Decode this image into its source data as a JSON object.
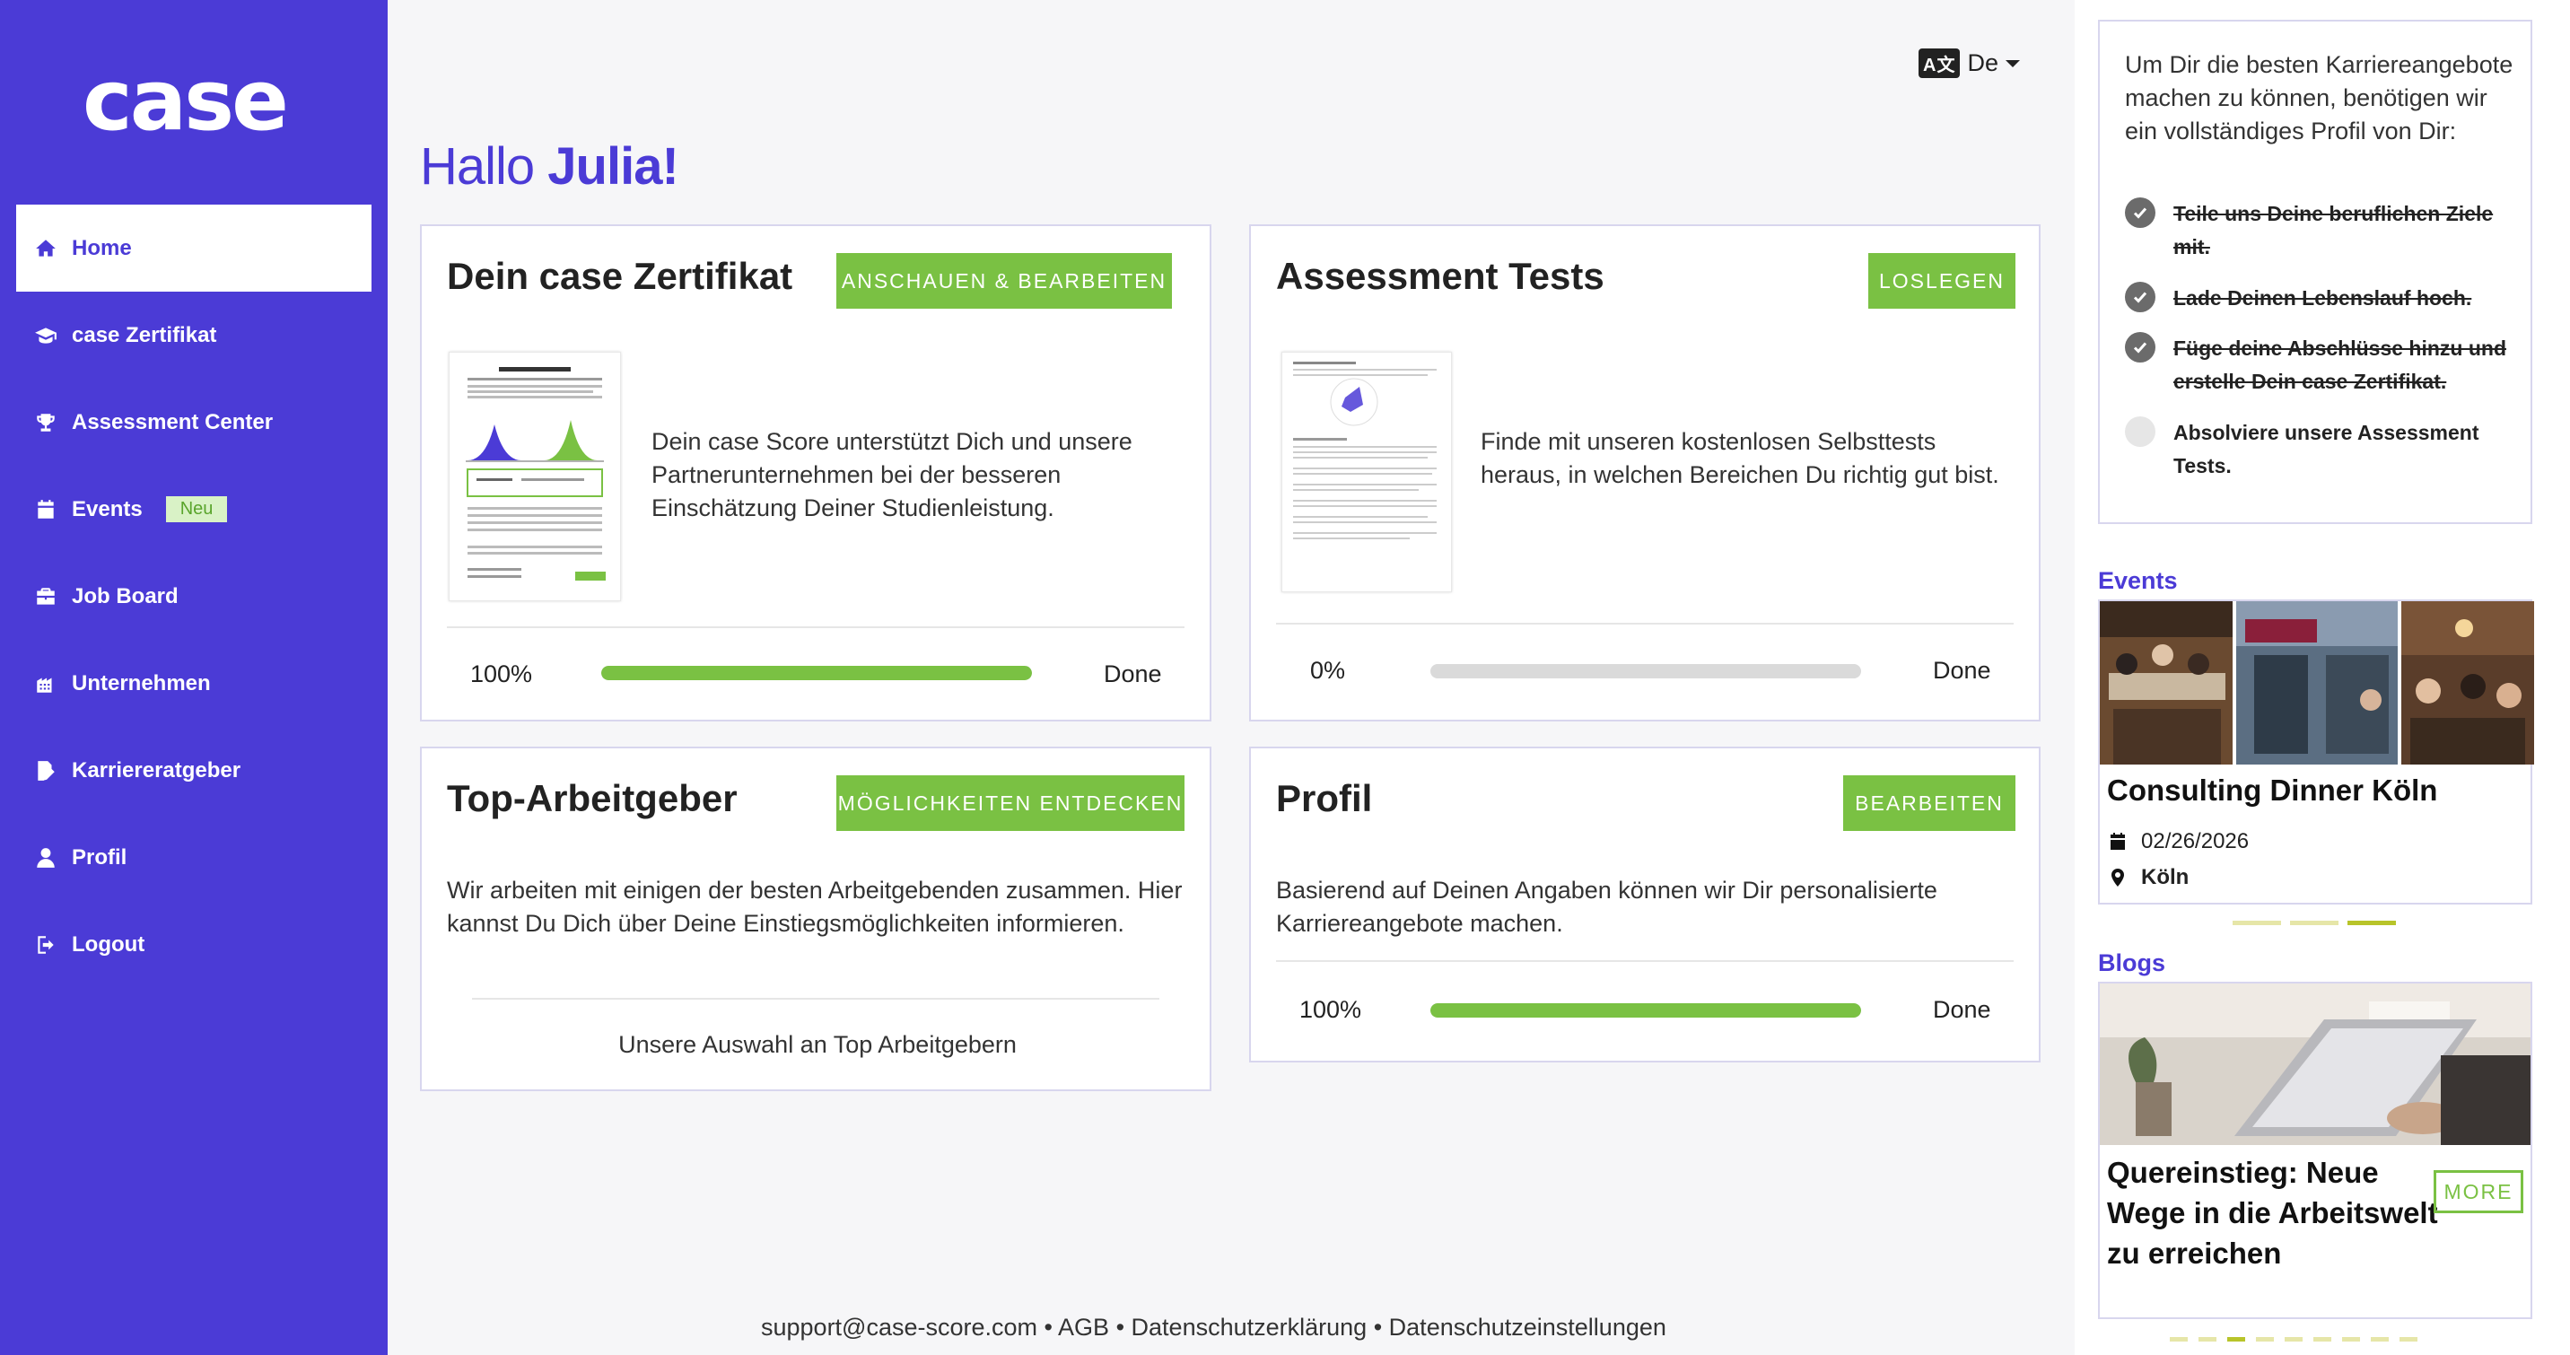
{
  "brand": {
    "logo_text": "case",
    "accent": "#4b3bd6",
    "green": "#7ac143"
  },
  "sidebar": {
    "items": [
      {
        "label": "Home",
        "icon": "home-icon",
        "active": true
      },
      {
        "label": "case Zertifikat",
        "icon": "graduation-cap-icon"
      },
      {
        "label": "Assessment Center",
        "icon": "trophy-icon"
      },
      {
        "label": "Events",
        "icon": "calendar-icon",
        "badge": "Neu"
      },
      {
        "label": "Job Board",
        "icon": "briefcase-icon"
      },
      {
        "label": "Unternehmen",
        "icon": "building-icon"
      },
      {
        "label": "Karriereratgeber",
        "icon": "edit-file-icon"
      },
      {
        "label": "Profil",
        "icon": "user-icon"
      },
      {
        "label": "Logout",
        "icon": "logout-icon"
      }
    ]
  },
  "header": {
    "language": "De",
    "language_icon": "translate-icon"
  },
  "greeting": {
    "prefix": "Hallo",
    "name": "Julia!"
  },
  "cards": {
    "certificate": {
      "title": "Dein case Zertifikat",
      "button": "ANSCHAUEN & BEARBEITEN",
      "text": "Dein case Score unterstützt Dich und unsere Partnerunternehmen bei der besseren Einschätzung Deiner Studienleistung.",
      "progress_label": "100%",
      "progress": 1.0,
      "status": "Done"
    },
    "assessment": {
      "title": "Assessment Tests",
      "button": "LOSLEGEN",
      "text": "Finde mit unseren kostenlosen Selbsttests heraus, in welchen Bereichen Du richtig gut bist.",
      "progress_label": "0%",
      "progress": 0.0,
      "status": "Done"
    },
    "employers": {
      "title": "Top-Arbeitgeber",
      "button": "MÖGLICHKEITEN ENTDECKEN",
      "text": "Wir arbeiten mit einigen der besten Arbeitgebenden zusammen. Hier kannst Du Dich über Deine Einstiegsmöglichkeiten informieren.",
      "link": "Unsere Auswahl an Top Arbeitgebern"
    },
    "profile": {
      "title": "Profil",
      "button": "BEARBEITEN",
      "text": "Basierend auf Deinen Angaben können wir Dir personalisierte Karriereangebote machen.",
      "progress_label": "100%",
      "progress": 1.0,
      "status": "Done"
    }
  },
  "checklist": {
    "intro": "Um Dir die besten Karriereangebote machen zu können, benötigen wir ein vollständiges Profil von Dir:",
    "items": [
      {
        "text": "Teile uns Deine beruflichen Ziele mit.",
        "done": true
      },
      {
        "text": "Lade Deinen Lebenslauf hoch.",
        "done": true
      },
      {
        "text": "Füge deine Abschlüsse hinzu und erstelle Dein case Zertifikat.",
        "done": true
      },
      {
        "text": "Absolviere unsere Assessment Tests.",
        "done": false
      }
    ]
  },
  "events": {
    "section_title": "Events",
    "title": "Consulting Dinner Köln",
    "date": "02/26/2026",
    "location": "Köln"
  },
  "blogs": {
    "section_title": "Blogs",
    "title": "Quereinstieg: Neue Wege in die Arbeitswelt zu erreichen",
    "button": "MORE"
  },
  "footer": {
    "email": "support@case-score.com",
    "sep": "•",
    "agb": "AGB",
    "privacy": "Datenschutzerklärung",
    "privacy_settings": "Datenschutzeinstellungen"
  }
}
